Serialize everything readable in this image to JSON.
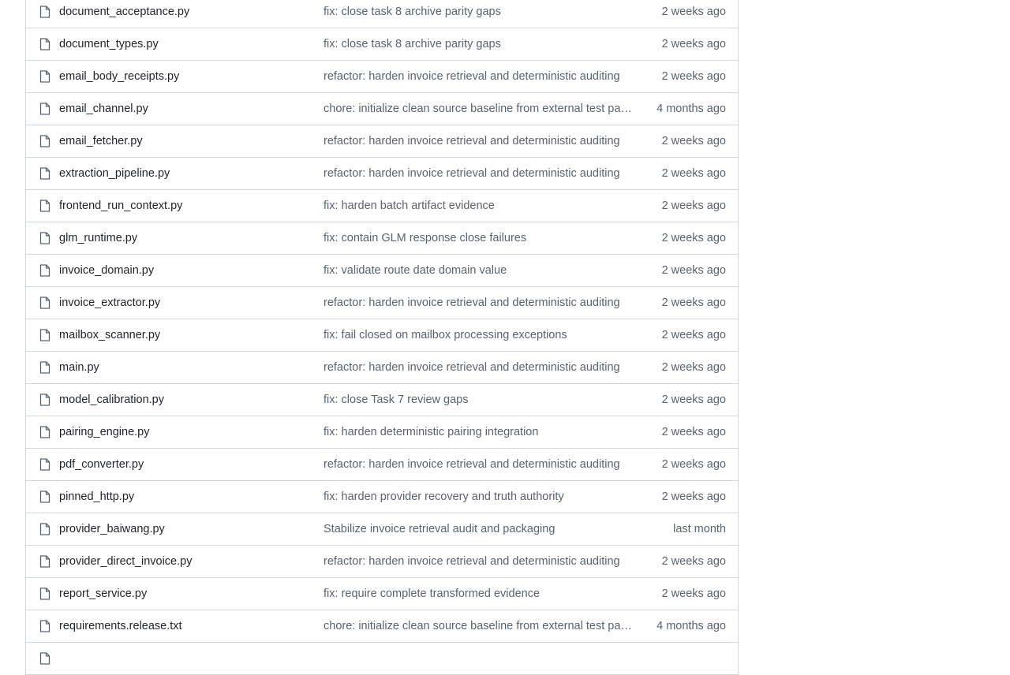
{
  "files": [
    {
      "name": "document_acceptance.py",
      "message": "fix: close task 8 archive parity gaps",
      "age": "2 weeks ago",
      "icon": "file-icon"
    },
    {
      "name": "document_types.py",
      "message": "fix: close task 8 archive parity gaps",
      "age": "2 weeks ago",
      "icon": "file-icon"
    },
    {
      "name": "email_body_receipts.py",
      "message": "refactor: harden invoice retrieval and deterministic auditing",
      "age": "2 weeks ago",
      "icon": "file-icon"
    },
    {
      "name": "email_channel.py",
      "message": "chore: initialize clean source baseline from external test pa…",
      "age": "4 months ago",
      "icon": "file-icon"
    },
    {
      "name": "email_fetcher.py",
      "message": "refactor: harden invoice retrieval and deterministic auditing",
      "age": "2 weeks ago",
      "icon": "file-icon"
    },
    {
      "name": "extraction_pipeline.py",
      "message": "refactor: harden invoice retrieval and deterministic auditing",
      "age": "2 weeks ago",
      "icon": "file-icon"
    },
    {
      "name": "frontend_run_context.py",
      "message": "fix: harden batch artifact evidence",
      "age": "2 weeks ago",
      "icon": "file-icon"
    },
    {
      "name": "glm_runtime.py",
      "message": "fix: contain GLM response close failures",
      "age": "2 weeks ago",
      "icon": "file-icon"
    },
    {
      "name": "invoice_domain.py",
      "message": "fix: validate route date domain value",
      "age": "2 weeks ago",
      "icon": "file-icon"
    },
    {
      "name": "invoice_extractor.py",
      "message": "refactor: harden invoice retrieval and deterministic auditing",
      "age": "2 weeks ago",
      "icon": "file-icon"
    },
    {
      "name": "mailbox_scanner.py",
      "message": "fix: fail closed on mailbox processing exceptions",
      "age": "2 weeks ago",
      "icon": "file-icon"
    },
    {
      "name": "main.py",
      "message": "refactor: harden invoice retrieval and deterministic auditing",
      "age": "2 weeks ago",
      "icon": "file-icon"
    },
    {
      "name": "model_calibration.py",
      "message": "fix: close Task 7 review gaps",
      "age": "2 weeks ago",
      "icon": "file-icon"
    },
    {
      "name": "pairing_engine.py",
      "message": "fix: harden deterministic pairing integration",
      "age": "2 weeks ago",
      "icon": "file-icon"
    },
    {
      "name": "pdf_converter.py",
      "message": "refactor: harden invoice retrieval and deterministic auditing",
      "age": "2 weeks ago",
      "icon": "file-icon"
    },
    {
      "name": "pinned_http.py",
      "message": "fix: harden provider recovery and truth authority",
      "age": "2 weeks ago",
      "icon": "file-icon"
    },
    {
      "name": "provider_baiwang.py",
      "message": "Stabilize invoice retrieval audit and packaging",
      "age": "last month",
      "icon": "file-icon"
    },
    {
      "name": "provider_direct_invoice.py",
      "message": "refactor: harden invoice retrieval and deterministic auditing",
      "age": "2 weeks ago",
      "icon": "file-icon"
    },
    {
      "name": "report_service.py",
      "message": "fix: require complete transformed evidence",
      "age": "2 weeks ago",
      "icon": "file-icon"
    },
    {
      "name": "requirements.release.txt",
      "message": "chore: initialize clean source baseline from external test pa…",
      "age": "4 months ago",
      "icon": "file-icon"
    },
    {
      "name": "",
      "message": "",
      "age": "",
      "icon": "file-icon"
    }
  ],
  "colors": {
    "border": "#d1d9e0",
    "text": "#1f2328",
    "muted": "#59636e",
    "link": "#0969da"
  }
}
